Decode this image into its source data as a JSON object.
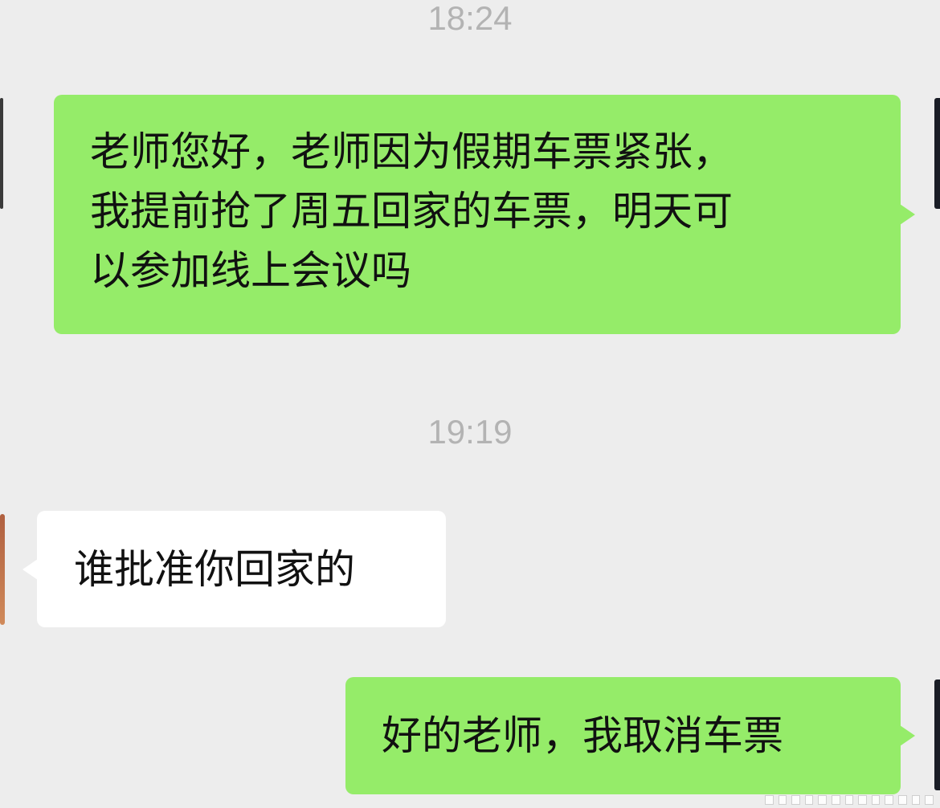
{
  "chat": {
    "timestamps": [
      "18:24",
      "19:19"
    ],
    "messages": [
      {
        "side": "sent",
        "lines": [
          "老师您好，老师因为假期车票紧张，",
          "我提前抢了周五回家的车票，明天可",
          "以参加线上会议吗"
        ]
      },
      {
        "side": "received",
        "lines": [
          "谁批准你回家的"
        ]
      },
      {
        "side": "sent",
        "lines": [
          "好的老师，我取消车票"
        ]
      }
    ]
  },
  "colors": {
    "background": "#ededed",
    "sent_bubble": "#95ec69",
    "received_bubble": "#ffffff",
    "timestamp_text": "#b3b3b3",
    "message_text": "#111111"
  }
}
